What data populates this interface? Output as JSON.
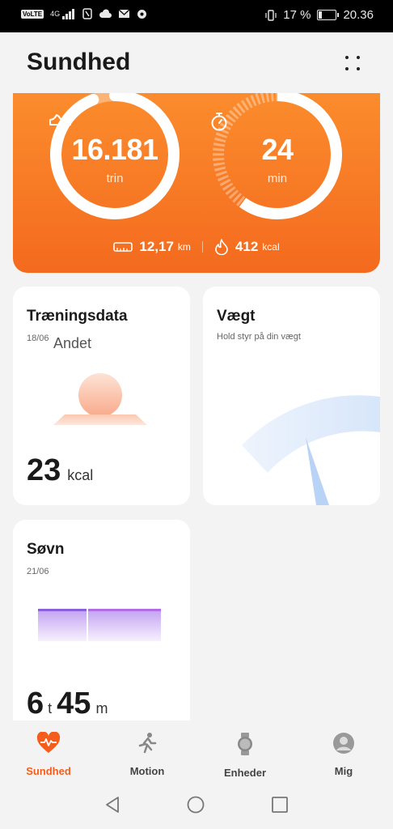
{
  "status_bar": {
    "volte": "VoLTE",
    "network": "4G",
    "battery_percent": "17 %",
    "battery_level": 0.17,
    "time": "20.36"
  },
  "header": {
    "title": "Sundhed"
  },
  "summary": {
    "steps": {
      "value": "16.181",
      "unit": "trin",
      "progress": 0.94
    },
    "duration": {
      "value": "24",
      "unit": "min",
      "progress": 0.6
    },
    "distance": {
      "value": "12,17",
      "unit": "km"
    },
    "calories": {
      "value": "412",
      "unit": "kcal"
    },
    "colors": {
      "gradient_top": "#fb8c2d",
      "gradient_bottom": "#f46a1e"
    }
  },
  "cards": {
    "training": {
      "title": "Træningsdata",
      "date": "18/06",
      "activity": "Andet",
      "value": "23",
      "unit": "kcal"
    },
    "weight": {
      "title": "Vægt",
      "subtitle": "Hold styr på din vægt"
    },
    "sleep": {
      "title": "Søvn",
      "date": "21/06",
      "hours": "6",
      "hours_unit": "t",
      "minutes": "45",
      "minutes_unit": "m"
    }
  },
  "nav": {
    "items": [
      {
        "label": "Sundhed",
        "icon": "heart-pulse-icon",
        "active": true
      },
      {
        "label": "Motion",
        "icon": "runner-icon",
        "active": false
      },
      {
        "label": "Enheder",
        "icon": "watch-icon",
        "active": false
      },
      {
        "label": "Mig",
        "icon": "person-icon",
        "active": false
      }
    ],
    "accent": "#f45d1c"
  },
  "system_nav": {
    "icons": [
      "back-icon",
      "home-icon",
      "recents-icon"
    ]
  }
}
